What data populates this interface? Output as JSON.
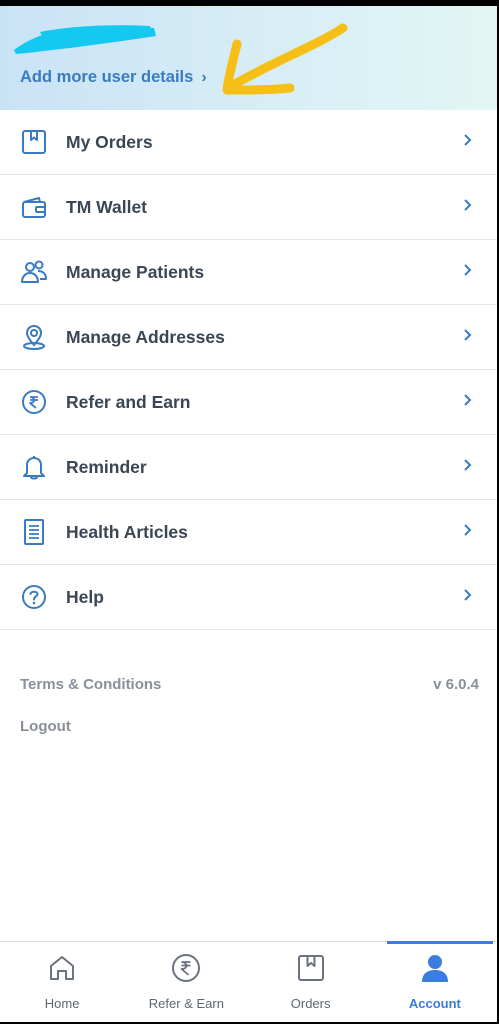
{
  "header": {
    "add_details_label": "Add more user details",
    "chevron": "›"
  },
  "menu": {
    "items": [
      {
        "label": "My Orders",
        "icon": "orders-icon"
      },
      {
        "label": "TM Wallet",
        "icon": "wallet-icon"
      },
      {
        "label": "Manage Patients",
        "icon": "patients-icon"
      },
      {
        "label": "Manage Addresses",
        "icon": "location-pin-icon"
      },
      {
        "label": "Refer and Earn",
        "icon": "rupee-icon"
      },
      {
        "label": "Reminder",
        "icon": "bell-icon"
      },
      {
        "label": "Health Articles",
        "icon": "document-icon"
      },
      {
        "label": "Help",
        "icon": "help-icon"
      }
    ]
  },
  "footer": {
    "terms": "Terms & Conditions",
    "version": "v 6.0.4",
    "logout": "Logout"
  },
  "bottom_nav": {
    "tabs": [
      {
        "label": "Home",
        "icon": "home-icon"
      },
      {
        "label": "Refer & Earn",
        "icon": "rupee-icon"
      },
      {
        "label": "Orders",
        "icon": "orders-icon"
      },
      {
        "label": "Account",
        "icon": "account-icon",
        "active": true
      }
    ]
  },
  "colors": {
    "accent": "#3b7ddd",
    "icon_blue": "#3a7bc0",
    "annotation": "#f5bf18",
    "redaction": "#14c8f0"
  }
}
